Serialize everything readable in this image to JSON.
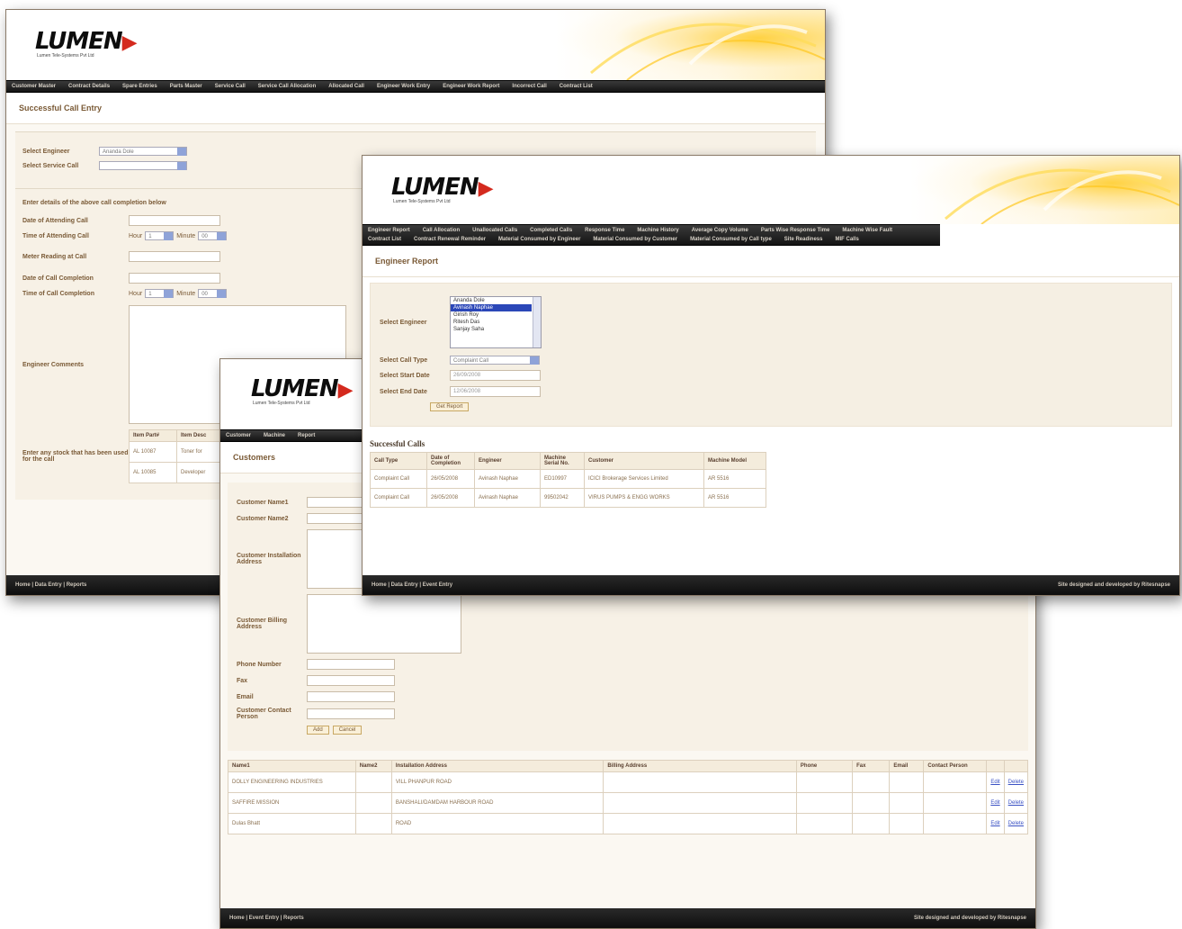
{
  "brand": {
    "logo": "LUMEN",
    "tagline": "Lumen Tele-Systems Pvt Ltd"
  },
  "win1": {
    "nav": [
      "Customer Master",
      "Contract Details",
      "Spare Entries",
      "Parts Master",
      "Service Call",
      "Service Call Allocation",
      "Allocated Call",
      "Engineer Work Entry",
      "Engineer Work Report",
      "Incorrect Call",
      "Contract List"
    ],
    "title": "Successful Call Entry",
    "select_engineer_label": "Select Engineer",
    "select_engineer_value": "Ananda Dole",
    "select_service_call_label": "Select Service Call",
    "details_heading": "Enter details of the above call completion below",
    "date_attending_label": "Date of Attending Call",
    "time_attending_label": "Time of Attending Call",
    "hour_label": "Hour",
    "hour_value": "1",
    "minute_label": "Minute",
    "minute_value": "00",
    "meter_label": "Meter Reading at Call",
    "date_completion_label": "Date of Call Completion",
    "time_completion_label": "Time of Call Completion",
    "comments_label": "Engineer Comments",
    "stock_label": "Enter any stock that has been used for the call",
    "stock_headers": [
      "Item Part#",
      "Item Desc"
    ],
    "stock_rows": [
      [
        "AL 10087",
        "Toner for"
      ],
      [
        "AL 10085",
        "Developer"
      ]
    ],
    "footer_left": "Home | Data Entry | Reports"
  },
  "win2": {
    "nav": [
      "Engineer Report",
      "Call Allocation",
      "Unallocated Calls",
      "Completed Calls",
      "Response Time",
      "Machine History",
      "Average Copy Volume",
      "Parts Wise Response Time",
      "Machine Wise Fault",
      "Contract List",
      "Contract Renewal Reminder",
      "Material Consumed by Engineer",
      "Material Consumed by Customer",
      "Material Consumed by Call type",
      "Site Readiness",
      "MIF Calls"
    ],
    "title": "Engineer Report",
    "select_engineer_label": "Select Engineer",
    "engineer_options": [
      "Ananda Dole",
      "Avinash Naphae",
      "Girish Roy",
      "Ritesh Das",
      "Sanjay Saha"
    ],
    "selected_engineer": "Avinash Naphae",
    "call_type_label": "Select Call Type",
    "call_type_value": "Complaint Call",
    "start_date_label": "Select Start Date",
    "start_date_value": "26/09/2008",
    "end_date_label": "Select End Date",
    "end_date_value": "12/06/2008",
    "get_report_button": "Get Report",
    "calls_caption": "Successful Calls",
    "table_headers": [
      "Call Type",
      "Date of Completion",
      "Engineer",
      "Machine Serial No.",
      "Customer",
      "Machine Model"
    ],
    "table_rows": [
      [
        "Complaint Call",
        "26/05/2008",
        "Avinash Naphae",
        "ED10997",
        "ICICI Brokerage Services Limited",
        "AR 5516"
      ],
      [
        "Complaint Call",
        "26/05/2008",
        "Avinash Naphae",
        "99502042",
        "VIRUS PUMPS & ENGG WORKS",
        "AR 5516"
      ]
    ],
    "footer_left": "Home | Data Entry | Event Entry",
    "footer_right": "Site designed and developed by Ritesnapse"
  },
  "win3": {
    "nav": [
      "Customer",
      "Machine",
      "Report"
    ],
    "title": "Customers",
    "name1_label": "Customer Name1",
    "name2_label": "Customer Name2",
    "install_label": "Customer Installation Address",
    "billing_label": "Customer Billing Address",
    "phone_label": "Phone Number",
    "fax_label": "Fax",
    "email_label": "Email",
    "contact_label": "Customer Contact Person",
    "add_button": "Add",
    "cancel_button": "Cancel",
    "table_headers": [
      "Name1",
      "Name2",
      "Installation Address",
      "Billing Address",
      "Phone",
      "Fax",
      "Email",
      "Contact Person",
      "",
      ""
    ],
    "table_rows": [
      [
        "DOLLY ENGINEERING INDUSTRIES",
        "",
        "VILL PHANPUR ROAD",
        "",
        "",
        "",
        "",
        "",
        "Edit",
        "Delete"
      ],
      [
        "SAFFIRE MISSION",
        "",
        "BANSHALI/DAMDAM HARBOUR ROAD",
        "",
        "",
        "",
        "",
        "",
        "Edit",
        "Delete"
      ],
      [
        "Dulas Bhatt",
        "",
        "ROAD",
        "",
        "",
        "",
        "",
        "",
        "Edit",
        "Delete"
      ]
    ],
    "footer_left": "Home | Event Entry | Reports",
    "footer_right": "Site designed and developed by Ritesnapse"
  }
}
